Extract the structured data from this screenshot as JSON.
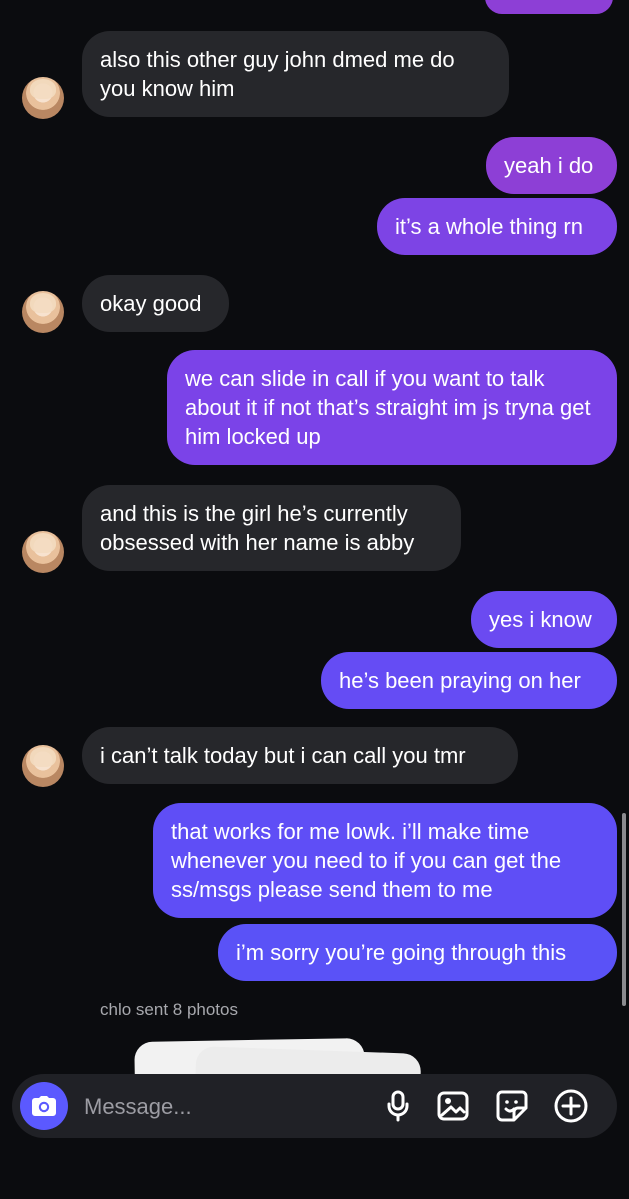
{
  "colors": {
    "background": "#0b0c0f",
    "incoming_bubble": "#26272b",
    "outgoing_purple": "#8d3fd6",
    "outgoing_blue": "#5b59ff"
  },
  "messages": [
    {
      "sender": "chlo",
      "text": "also this other guy john dmed me do you know him"
    },
    {
      "sender": "me",
      "text": "yeah i do"
    },
    {
      "sender": "me",
      "text": "it’s a whole thing rn"
    },
    {
      "sender": "chlo",
      "text": "okay good"
    },
    {
      "sender": "me",
      "text": "we can slide in call if you want to talk about it if not that’s straight im js tryna get him locked up"
    },
    {
      "sender": "chlo",
      "text": "and this is the girl he’s currently obsessed with her name is abby"
    },
    {
      "sender": "me",
      "text": "yes i know"
    },
    {
      "sender": "me",
      "text": "he’s been praying on her"
    },
    {
      "sender": "chlo",
      "text": "i can’t talk today but i can call you tmr"
    },
    {
      "sender": "me",
      "text": "that works for me lowk. i’ll make time whenever you need to if you can get the ss/msgs please send them to me"
    },
    {
      "sender": "me",
      "text": "i’m sorry you’re going through this"
    }
  ],
  "system_note": "chlo sent 8 photos",
  "composer": {
    "placeholder": "Message...",
    "icons": [
      "camera-icon",
      "microphone-icon",
      "gallery-icon",
      "sticker-icon",
      "plus-circle-icon"
    ]
  }
}
